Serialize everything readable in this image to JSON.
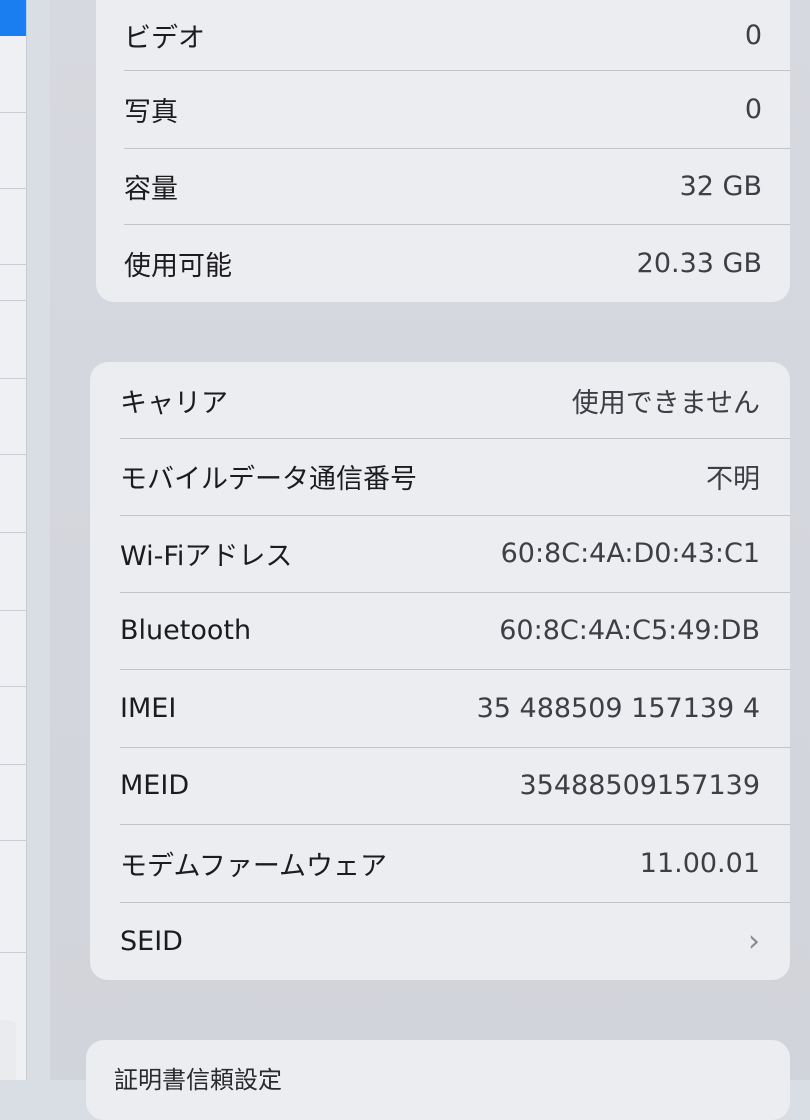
{
  "storage": [
    {
      "label": "ビデオ",
      "value": "0"
    },
    {
      "label": "写真",
      "value": "0"
    },
    {
      "label": "容量",
      "value": "32 GB"
    },
    {
      "label": "使用可能",
      "value": "20.33 GB"
    }
  ],
  "network": [
    {
      "label": "キャリア",
      "value": "使用できません"
    },
    {
      "label": "モバイルデータ通信番号",
      "value": "不明"
    },
    {
      "label": "Wi-Fiアドレス",
      "value": "60:8C:4A:D0:43:C1"
    },
    {
      "label": "Bluetooth",
      "value": "60:8C:4A:C5:49:DB"
    },
    {
      "label": "IMEI",
      "value": "35 488509 157139 4"
    },
    {
      "label": "MEID",
      "value": "35488509157139"
    },
    {
      "label": "モデムファームウェア",
      "value": "11.00.01"
    },
    {
      "label": "SEID",
      "value": "›"
    }
  ],
  "bottom": {
    "label": "証明書信頼設定"
  },
  "colors": {
    "accent": "#1a7ef0",
    "background": "#d6d9df",
    "group": "#ecedf0"
  }
}
